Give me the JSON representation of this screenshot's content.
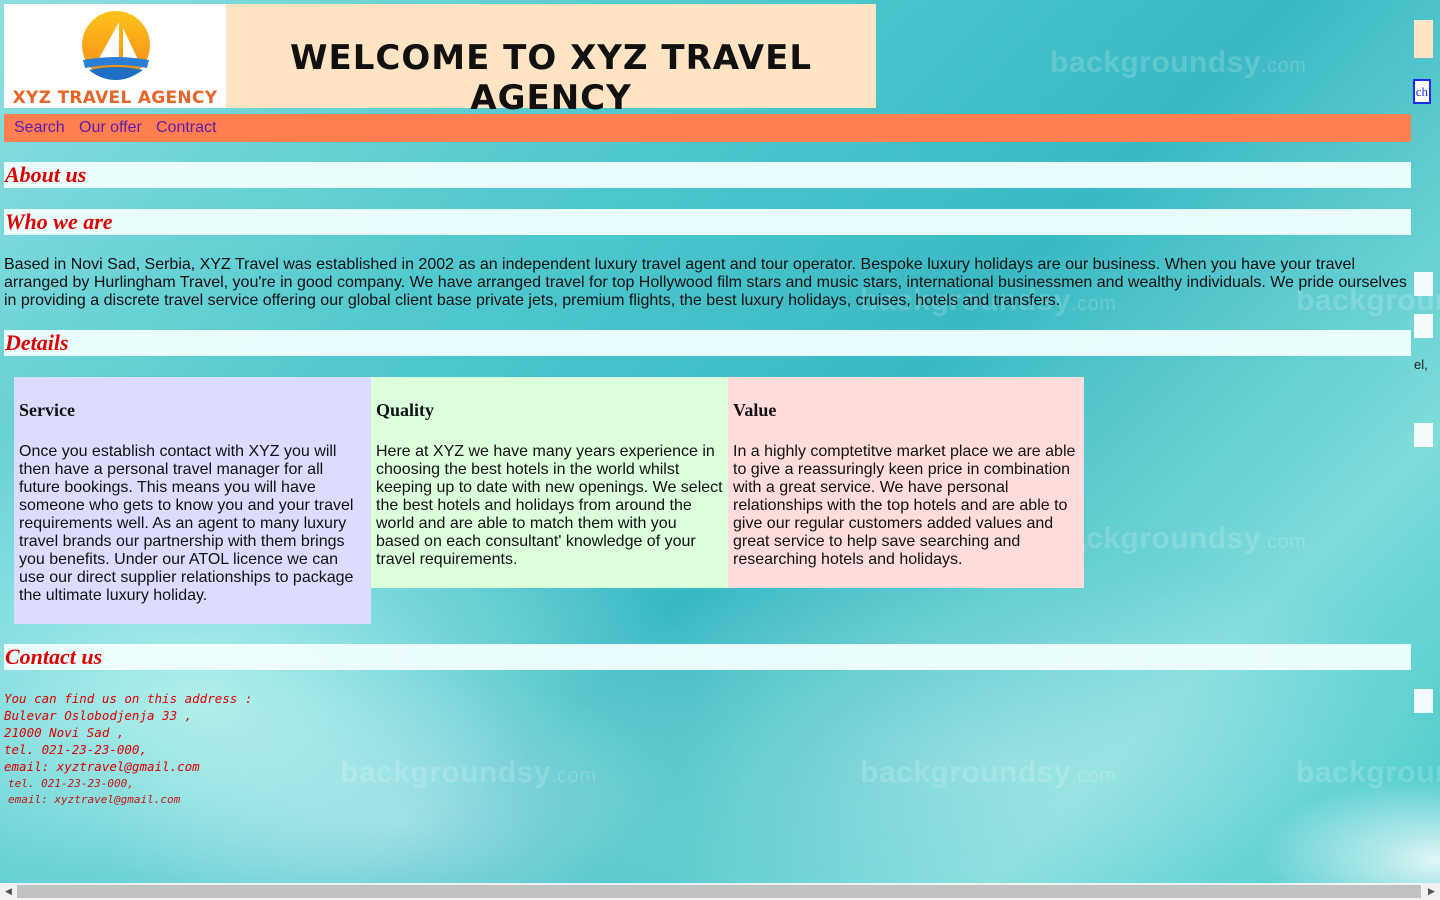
{
  "header": {
    "logo_text": "XYZ TRAVEL AGENCY",
    "banner_title": "WELCOME TO XYZ TRAVEL AGENCY"
  },
  "nav": {
    "items": [
      "Search",
      "Our offer",
      "Contract"
    ]
  },
  "sections": {
    "about": "About us",
    "who": "Who we are",
    "details": "Details",
    "contact": "Contact us"
  },
  "about_text": "Based in Novi Sad, Serbia, XYZ Travel was established in 2002 as an independent luxury travel agent and tour operator. Bespoke luxury holidays are our business. When you have your travel arranged by Hurlingham Travel, you're in good company. We have arranged travel for top Hollywood film stars and music stars, international businessmen and wealthy individuals. We pride ourselves in providing a discrete travel service offering our global client base private jets, premium flights, the best luxury holidays, cruises, hotels and transfers.",
  "cards": [
    {
      "title": "Service",
      "text": "Once you establish contact with XYZ you will then have a personal travel manager for all future bookings. This means you will have someone who gets to know you and your travel requirements well. As an agent to many luxury travel brands our partnership with them brings you benefits. Under our ATOL licence we can use our direct supplier relationships to package the ultimate luxury holiday.",
      "color": "#dcdcff"
    },
    {
      "title": "Quality",
      "text": "Here at XYZ we have many years experience in choosing the best hotels in the world whilst keeping up to date with new openings. We select the best hotels and holidays from around the world and are able to match them with you based on each consultant' knowledge of your travel requirements.",
      "color": "#dcffdc"
    },
    {
      "title": "Value",
      "text": "In a highly comptetitve market place we are able to give a reassuringly keen price in combination with a great service. We have personal relationships with the top hotels and are able to give our regular customers added values and great service to help save searching and researching hotels and holidays.",
      "color": "#ffdcdc"
    }
  ],
  "contact": {
    "lines": [
      "You can find us on this address :",
      "Bulevar Oslobodjenja 33 ,",
      "21000 Novi Sad ,",
      "tel. 021-23-23-000,",
      "email: xyztravel@gmail.com"
    ],
    "ghost_lines": [
      "tel. 021-23-23-000,",
      "email: xyztravel@gmail.com"
    ]
  },
  "right_edge": {
    "search_button_fragment": "ch",
    "text_fragment": "el,"
  },
  "watermark_text": "backgroundsy",
  "watermark_suffix": ".com"
}
